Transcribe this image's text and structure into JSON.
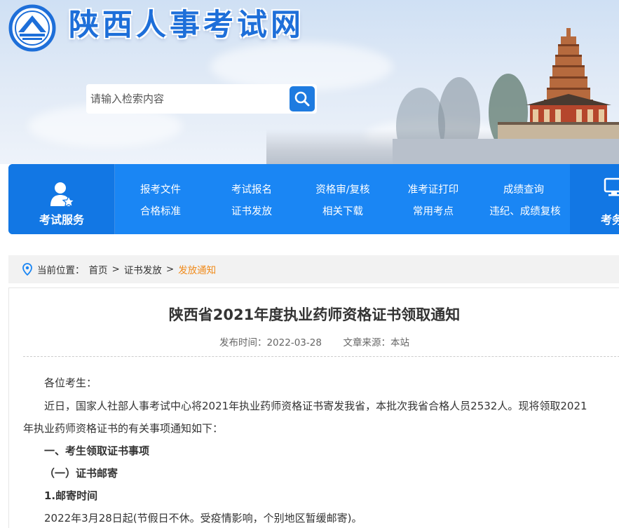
{
  "site": {
    "title": "陕西人事考试网",
    "emblem_icon": "shaanxi-emblem-icon",
    "brand_color": "#1e6fd9"
  },
  "search": {
    "placeholder": "请输入检索内容",
    "button_icon": "search-icon"
  },
  "nav": {
    "service_label": "考试服务",
    "service_icon": "user-service-icon",
    "links_row1": [
      "报考文件",
      "考试报名",
      "资格审/复核",
      "准考证打印",
      "成绩查询"
    ],
    "links_row2": [
      "合格标准",
      "证书发放",
      "相关下载",
      "常用考点",
      "违纪、成绩复核"
    ],
    "right_label": "考务",
    "right_icon": "monitor-icon",
    "color": "#1a86f4"
  },
  "breadcrumb": {
    "prefix": "当前位置：",
    "items": [
      "首页",
      "证书发放",
      "发放通知"
    ],
    "separator": ">",
    "current_color": "#f08a1a"
  },
  "article": {
    "title": "陕西省2021年度执业药师资格证书领取通知",
    "publish_label": "发布时间：",
    "publish_date": "2022-03-28",
    "source_label": "文章来源：",
    "source": "本站",
    "paragraphs": [
      "各位考生：",
      "近日，国家人社部人事考试中心将2021年执业药师资格证书寄发我省，本批次我省合格人员2532人。现将领取2021",
      "年执业药师资格证书的有关事项通知如下：",
      "一、考生领取证书事项",
      "（一）证书邮寄",
      "1.邮寄时间",
      "2022年3月28日起(节假日不休。受疫情影响，个别地区暂缓邮寄)。"
    ]
  }
}
